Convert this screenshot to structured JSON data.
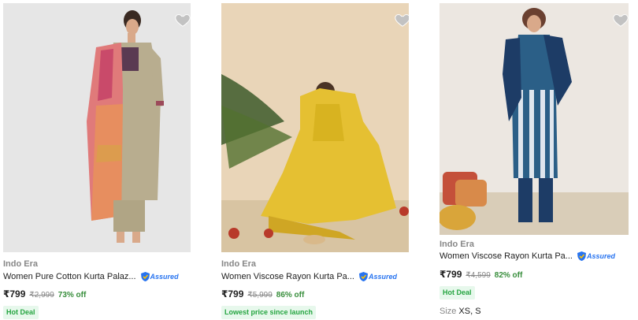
{
  "products": [
    {
      "brand": "Indo Era",
      "title": "Women Pure Cotton Kurta Palaz...",
      "assured": "Assured",
      "price": "₹799",
      "mrp": "₹2,999",
      "discount": "73% off",
      "badge": "Hot Deal",
      "image": "model-pink-dupatta-beige-kurta",
      "wishlist_icon": "heart-icon"
    },
    {
      "brand": "Indo Era",
      "title": "Women Viscose Rayon Kurta Pa...",
      "assured": "Assured",
      "price": "₹799",
      "mrp": "₹5,999",
      "discount": "86% off",
      "badge": "Lowest price since launch",
      "image": "model-yellow-kurta-set",
      "wishlist_icon": "heart-icon"
    },
    {
      "brand": "Indo Era",
      "title": "Women Viscose Rayon Kurta Pa...",
      "assured": "Assured",
      "price": "₹799",
      "mrp": "₹4,599",
      "discount": "82% off",
      "badge": "Hot Deal",
      "size_label": "Size",
      "sizes": "XS, S",
      "image": "model-blue-striped-kurta",
      "wishlist_icon": "heart-icon"
    }
  ],
  "colors": {
    "price_green": "#388e3c",
    "badge_bg": "#e7f8ec",
    "assured_blue": "#2874f0"
  }
}
